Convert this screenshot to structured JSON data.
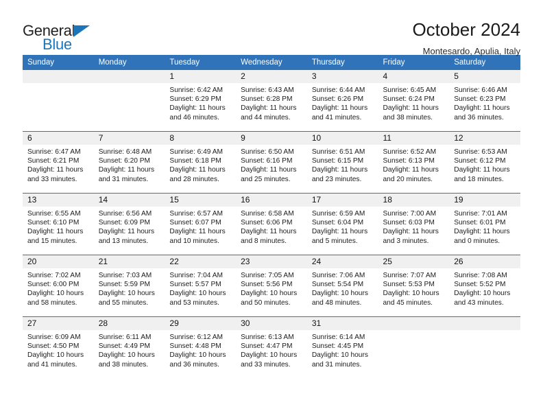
{
  "brand": {
    "name_top": "General",
    "name_bottom": "Blue",
    "triangle_color": "#1b75bb"
  },
  "header": {
    "title": "October 2024",
    "subtitle": "Montesardo, Apulia, Italy",
    "header_bg_color": "#3073b8",
    "daynum_bg_color": "#f0f0f0"
  },
  "weekday_headers": [
    "Sunday",
    "Monday",
    "Tuesday",
    "Wednesday",
    "Thursday",
    "Friday",
    "Saturday"
  ],
  "weeks": [
    [
      {
        "day": "",
        "sunrise": "",
        "sunset": "",
        "daylight_1": "",
        "daylight_2": ""
      },
      {
        "day": "",
        "sunrise": "",
        "sunset": "",
        "daylight_1": "",
        "daylight_2": ""
      },
      {
        "day": "1",
        "sunrise": "Sunrise: 6:42 AM",
        "sunset": "Sunset: 6:29 PM",
        "daylight_1": "Daylight: 11 hours",
        "daylight_2": "and 46 minutes."
      },
      {
        "day": "2",
        "sunrise": "Sunrise: 6:43 AM",
        "sunset": "Sunset: 6:28 PM",
        "daylight_1": "Daylight: 11 hours",
        "daylight_2": "and 44 minutes."
      },
      {
        "day": "3",
        "sunrise": "Sunrise: 6:44 AM",
        "sunset": "Sunset: 6:26 PM",
        "daylight_1": "Daylight: 11 hours",
        "daylight_2": "and 41 minutes."
      },
      {
        "day": "4",
        "sunrise": "Sunrise: 6:45 AM",
        "sunset": "Sunset: 6:24 PM",
        "daylight_1": "Daylight: 11 hours",
        "daylight_2": "and 38 minutes."
      },
      {
        "day": "5",
        "sunrise": "Sunrise: 6:46 AM",
        "sunset": "Sunset: 6:23 PM",
        "daylight_1": "Daylight: 11 hours",
        "daylight_2": "and 36 minutes."
      }
    ],
    [
      {
        "day": "6",
        "sunrise": "Sunrise: 6:47 AM",
        "sunset": "Sunset: 6:21 PM",
        "daylight_1": "Daylight: 11 hours",
        "daylight_2": "and 33 minutes."
      },
      {
        "day": "7",
        "sunrise": "Sunrise: 6:48 AM",
        "sunset": "Sunset: 6:20 PM",
        "daylight_1": "Daylight: 11 hours",
        "daylight_2": "and 31 minutes."
      },
      {
        "day": "8",
        "sunrise": "Sunrise: 6:49 AM",
        "sunset": "Sunset: 6:18 PM",
        "daylight_1": "Daylight: 11 hours",
        "daylight_2": "and 28 minutes."
      },
      {
        "day": "9",
        "sunrise": "Sunrise: 6:50 AM",
        "sunset": "Sunset: 6:16 PM",
        "daylight_1": "Daylight: 11 hours",
        "daylight_2": "and 25 minutes."
      },
      {
        "day": "10",
        "sunrise": "Sunrise: 6:51 AM",
        "sunset": "Sunset: 6:15 PM",
        "daylight_1": "Daylight: 11 hours",
        "daylight_2": "and 23 minutes."
      },
      {
        "day": "11",
        "sunrise": "Sunrise: 6:52 AM",
        "sunset": "Sunset: 6:13 PM",
        "daylight_1": "Daylight: 11 hours",
        "daylight_2": "and 20 minutes."
      },
      {
        "day": "12",
        "sunrise": "Sunrise: 6:53 AM",
        "sunset": "Sunset: 6:12 PM",
        "daylight_1": "Daylight: 11 hours",
        "daylight_2": "and 18 minutes."
      }
    ],
    [
      {
        "day": "13",
        "sunrise": "Sunrise: 6:55 AM",
        "sunset": "Sunset: 6:10 PM",
        "daylight_1": "Daylight: 11 hours",
        "daylight_2": "and 15 minutes."
      },
      {
        "day": "14",
        "sunrise": "Sunrise: 6:56 AM",
        "sunset": "Sunset: 6:09 PM",
        "daylight_1": "Daylight: 11 hours",
        "daylight_2": "and 13 minutes."
      },
      {
        "day": "15",
        "sunrise": "Sunrise: 6:57 AM",
        "sunset": "Sunset: 6:07 PM",
        "daylight_1": "Daylight: 11 hours",
        "daylight_2": "and 10 minutes."
      },
      {
        "day": "16",
        "sunrise": "Sunrise: 6:58 AM",
        "sunset": "Sunset: 6:06 PM",
        "daylight_1": "Daylight: 11 hours",
        "daylight_2": "and 8 minutes."
      },
      {
        "day": "17",
        "sunrise": "Sunrise: 6:59 AM",
        "sunset": "Sunset: 6:04 PM",
        "daylight_1": "Daylight: 11 hours",
        "daylight_2": "and 5 minutes."
      },
      {
        "day": "18",
        "sunrise": "Sunrise: 7:00 AM",
        "sunset": "Sunset: 6:03 PM",
        "daylight_1": "Daylight: 11 hours",
        "daylight_2": "and 3 minutes."
      },
      {
        "day": "19",
        "sunrise": "Sunrise: 7:01 AM",
        "sunset": "Sunset: 6:01 PM",
        "daylight_1": "Daylight: 11 hours",
        "daylight_2": "and 0 minutes."
      }
    ],
    [
      {
        "day": "20",
        "sunrise": "Sunrise: 7:02 AM",
        "sunset": "Sunset: 6:00 PM",
        "daylight_1": "Daylight: 10 hours",
        "daylight_2": "and 58 minutes."
      },
      {
        "day": "21",
        "sunrise": "Sunrise: 7:03 AM",
        "sunset": "Sunset: 5:59 PM",
        "daylight_1": "Daylight: 10 hours",
        "daylight_2": "and 55 minutes."
      },
      {
        "day": "22",
        "sunrise": "Sunrise: 7:04 AM",
        "sunset": "Sunset: 5:57 PM",
        "daylight_1": "Daylight: 10 hours",
        "daylight_2": "and 53 minutes."
      },
      {
        "day": "23",
        "sunrise": "Sunrise: 7:05 AM",
        "sunset": "Sunset: 5:56 PM",
        "daylight_1": "Daylight: 10 hours",
        "daylight_2": "and 50 minutes."
      },
      {
        "day": "24",
        "sunrise": "Sunrise: 7:06 AM",
        "sunset": "Sunset: 5:54 PM",
        "daylight_1": "Daylight: 10 hours",
        "daylight_2": "and 48 minutes."
      },
      {
        "day": "25",
        "sunrise": "Sunrise: 7:07 AM",
        "sunset": "Sunset: 5:53 PM",
        "daylight_1": "Daylight: 10 hours",
        "daylight_2": "and 45 minutes."
      },
      {
        "day": "26",
        "sunrise": "Sunrise: 7:08 AM",
        "sunset": "Sunset: 5:52 PM",
        "daylight_1": "Daylight: 10 hours",
        "daylight_2": "and 43 minutes."
      }
    ],
    [
      {
        "day": "27",
        "sunrise": "Sunrise: 6:09 AM",
        "sunset": "Sunset: 4:50 PM",
        "daylight_1": "Daylight: 10 hours",
        "daylight_2": "and 41 minutes."
      },
      {
        "day": "28",
        "sunrise": "Sunrise: 6:11 AM",
        "sunset": "Sunset: 4:49 PM",
        "daylight_1": "Daylight: 10 hours",
        "daylight_2": "and 38 minutes."
      },
      {
        "day": "29",
        "sunrise": "Sunrise: 6:12 AM",
        "sunset": "Sunset: 4:48 PM",
        "daylight_1": "Daylight: 10 hours",
        "daylight_2": "and 36 minutes."
      },
      {
        "day": "30",
        "sunrise": "Sunrise: 6:13 AM",
        "sunset": "Sunset: 4:47 PM",
        "daylight_1": "Daylight: 10 hours",
        "daylight_2": "and 33 minutes."
      },
      {
        "day": "31",
        "sunrise": "Sunrise: 6:14 AM",
        "sunset": "Sunset: 4:45 PM",
        "daylight_1": "Daylight: 10 hours",
        "daylight_2": "and 31 minutes."
      },
      {
        "day": "",
        "sunrise": "",
        "sunset": "",
        "daylight_1": "",
        "daylight_2": ""
      },
      {
        "day": "",
        "sunrise": "",
        "sunset": "",
        "daylight_1": "",
        "daylight_2": ""
      }
    ]
  ]
}
